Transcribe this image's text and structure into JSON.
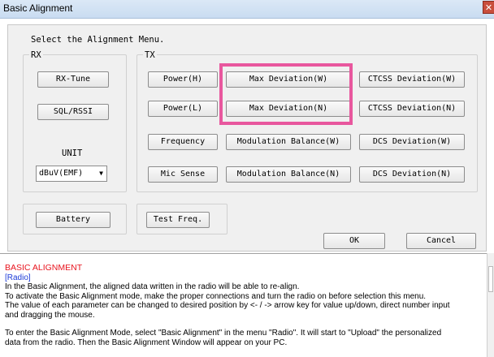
{
  "window": {
    "title": "Basic Alignment",
    "close_glyph": "✕"
  },
  "menu_prompt": "Select the Alignment Menu.",
  "rx": {
    "group_label": "RX",
    "rx_tune": "RX-Tune",
    "sql_rssi": "SQL/RSSI",
    "unit_label": "UNIT",
    "unit_value": "dBuV(EMF)",
    "battery": "Battery"
  },
  "tx": {
    "group_label": "TX",
    "power_h": "Power(H)",
    "power_l": "Power(L)",
    "frequency": "Frequency",
    "mic_sense": "Mic Sense",
    "max_dev_w": "Max Deviation(W)",
    "max_dev_n": "Max Deviation(N)",
    "mod_bal_w": "Modulation Balance(W)",
    "mod_bal_n": "Modulation Balance(N)",
    "ctcss_w": "CTCSS Deviation(W)",
    "ctcss_n": "CTCSS Deviation(N)",
    "dcs_w": "DCS Deviation(W)",
    "dcs_n": "DCS Deviation(N)"
  },
  "test_freq": "Test Freq.",
  "dialog": {
    "ok": "OK",
    "cancel": "Cancel"
  },
  "help": {
    "heading": "BASIC ALIGNMENT",
    "subheading": "[Radio]",
    "lines": [
      "In the Basic Alignment, the aligned data written in the radio will be able to re-align.",
      "To activate the Basic Alignment mode, make the proper connections and turn the radio on before selection this menu.",
      "The value of each parameter can be changed to desired position by <- / -> arrow key for value up/down, direct number input",
      "and dragging the mouse.",
      "To enter the Basic Alignment Mode, select \"Basic Alignment\" in the menu \"Radio\". It will start to \"Upload\" the personalized",
      "data from the radio. Then the Basic Alignment Window will appear on your PC."
    ]
  },
  "colors": {
    "highlight": "#e8579e",
    "heading": "#e8141e",
    "subheading": "#1e3cd8",
    "dialog_bg": "#f0f0f0"
  }
}
